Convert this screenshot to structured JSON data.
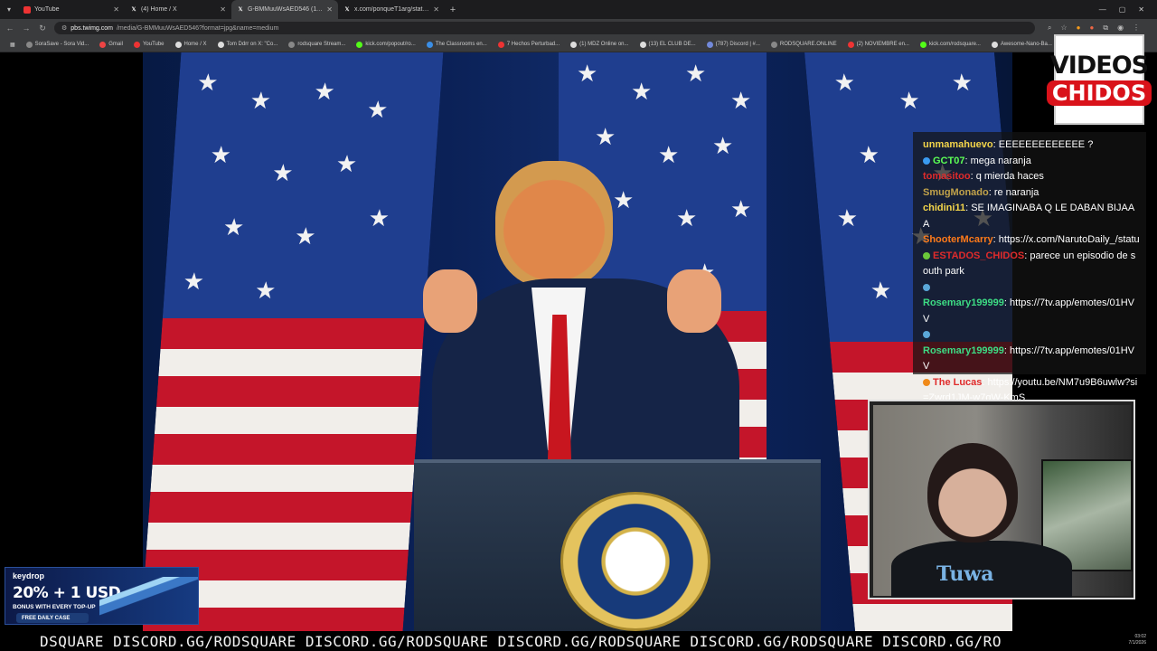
{
  "browser": {
    "tabs": [
      {
        "title": "YouTube",
        "icon": "youtube-icon",
        "active": false
      },
      {
        "title": "(4) Home / X",
        "icon": "x-icon",
        "active": false
      },
      {
        "title": "G-BMMuuWsAED546 (1100×7...",
        "icon": "x-icon",
        "active": true
      },
      {
        "title": "x.com/ponqueT1arg/status/20...",
        "icon": "x-icon",
        "active": false
      }
    ],
    "url_host": "pbs.twimg.com",
    "url_path": "/media/G-BMMuuWsAED546?format=jpg&name=medium",
    "bookmarks": [
      "SoraSave - Sora Vid...",
      "Gmail",
      "YouTube",
      "Home / X",
      "Tom Ddrr on X: \"Co...",
      "rodsquare Stream...",
      "kick.com/popout/ro...",
      "The Classrooms en...",
      "7 Hechos Perturbad...",
      "(1) MDZ Online on...",
      "(13) EL CLUB DE...",
      "(787) Discord | #...",
      "RODSQUARE.ONLINE",
      "(2) NOVIEMBRE en...",
      "kick.com/rodsquare...",
      "Awesome-Nano-Ba..."
    ]
  },
  "overlay": {
    "logo": {
      "line1": "VIDEOS",
      "line2": "CHIDOS"
    },
    "chat": [
      {
        "user": "unmamahuevo",
        "text": "EEEEEEEEEEEEE ?",
        "color": "#f3d54a",
        "badge": null
      },
      {
        "user": "GCT07",
        "text": "mega naranja",
        "color": "#5cff55",
        "badge": "#3a9af0"
      },
      {
        "user": "tomasitoo",
        "text": "q mierda haces",
        "color": "#e02b2b",
        "badge": null
      },
      {
        "user": "SmugMonado",
        "text": "re naranja",
        "color": "#c1a24a",
        "badge": null
      },
      {
        "user": "chidini11",
        "text": "SE IMAGINABA Q LE DABAN BIJAAA",
        "color": "#f3d54a",
        "badge": null
      },
      {
        "user": "ShooterMcarry",
        "text": "https://x.com/NarutoDaily_/statu",
        "color": "#ff7a1a",
        "badge": null
      },
      {
        "user": "ESTADOS_CHIDOS",
        "text": "parece un episodio de south park",
        "color": "#e02b2b",
        "badge": "#6ac83a"
      },
      {
        "user": "",
        "text": "",
        "color": "#ffffff",
        "badge": "#5aa7d8"
      },
      {
        "user": "Rosemary199999",
        "text": "https://7tv.app/emotes/01HVV",
        "color": "#3ddc84",
        "badge": null
      },
      {
        "user": "",
        "text": "",
        "color": "#ffffff",
        "badge": "#5aa7d8"
      },
      {
        "user": "Rosemary199999",
        "text": "https://7tv.app/emotes/01HVV",
        "color": "#3ddc84",
        "badge": null
      },
      {
        "user": "The Lucas",
        "text": "https://youtu.be/NM7u9B6uwlw?si=Zwrd1JM-w7qW-KmS",
        "color": "#e02b2b",
        "badge": "#f08a1a"
      }
    ],
    "ad": {
      "brand": "keydrop",
      "promo": "20% + 1 USD",
      "sub": "BONUS WITH EVERY TOP-UP",
      "cta": "FREE DAILY CASE"
    },
    "webcam_shirt": "Tuwa",
    "ticker": "DSQUARE DISCORD.GG/RODSQUARE DISCORD.GG/RODSQUARE DISCORD.GG/RODSQUARE DISCORD.GG/RODSQUARE DISCORD.GG/RO",
    "clock": {
      "time": "03:02",
      "date": "7/1/2026"
    }
  }
}
